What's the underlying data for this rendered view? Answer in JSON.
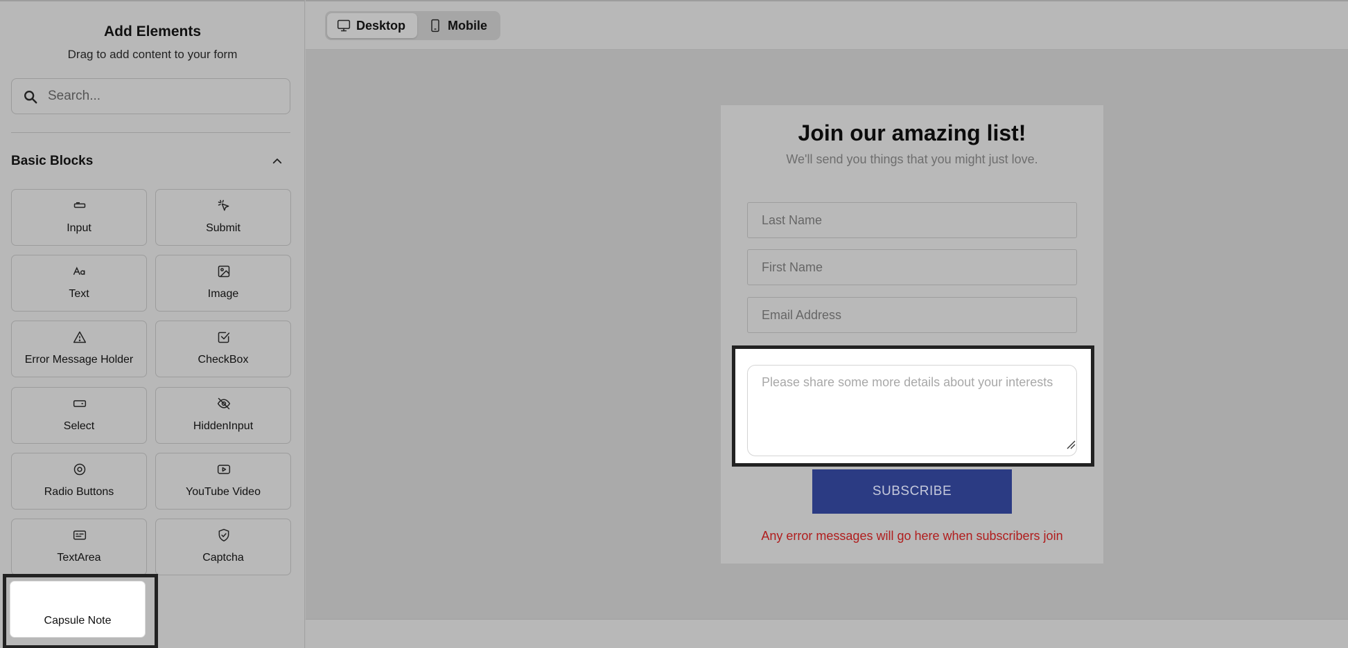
{
  "sidebar": {
    "title": "Add Elements",
    "subtitle": "Drag to add content to your form",
    "search_placeholder": "Search...",
    "section_title": "Basic Blocks",
    "blocks": [
      {
        "label": "Input",
        "icon": "input-icon"
      },
      {
        "label": "Submit",
        "icon": "pointer-click-icon"
      },
      {
        "label": "Text",
        "icon": "text-icon"
      },
      {
        "label": "Image",
        "icon": "image-icon"
      },
      {
        "label": "Error Message Holder",
        "icon": "warning-triangle-icon"
      },
      {
        "label": "CheckBox",
        "icon": "checkbox-icon"
      },
      {
        "label": "Select",
        "icon": "select-icon"
      },
      {
        "label": "HiddenInput",
        "icon": "eye-off-icon"
      },
      {
        "label": "Radio Buttons",
        "icon": "radio-icon"
      },
      {
        "label": "YouTube Video",
        "icon": "youtube-icon"
      },
      {
        "label": "TextArea",
        "icon": "textarea-icon"
      },
      {
        "label": "Captcha",
        "icon": "shield-check-icon"
      }
    ],
    "dragging_block": {
      "label": "Capsule Note"
    }
  },
  "toolbar": {
    "desktop_label": "Desktop",
    "mobile_label": "Mobile"
  },
  "form": {
    "title": "Join our amazing list!",
    "subtitle": "We'll send you things that you might just love.",
    "last_name_placeholder": "Last Name",
    "first_name_placeholder": "First Name",
    "email_placeholder": "Email Address",
    "details_placeholder": "Please share some more details about your interests",
    "subscribe_label": "SUBSCRIBE",
    "error_text": "Any error messages will go here when subscribers join"
  },
  "colors": {
    "subscribe_bg": "#2b3b83",
    "error_text": "#b01d1d"
  }
}
